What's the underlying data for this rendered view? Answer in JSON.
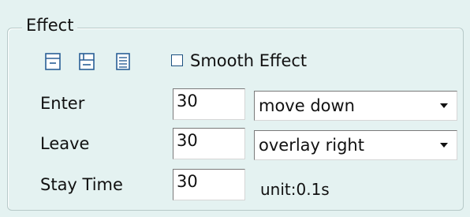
{
  "effect": {
    "title": "Effect",
    "toolbar_icons": [
      "page-top-icon",
      "page-middle-icon",
      "page-lines-icon"
    ],
    "smooth_effect_label": "Smooth Effect",
    "smooth_effect_checked": false,
    "rows": [
      {
        "label": "Enter",
        "value": "30",
        "select": "move down"
      },
      {
        "label": "Leave",
        "value": "30",
        "select": "overlay right"
      },
      {
        "label": "Stay Time",
        "value": "30",
        "unit": "unit:0.1s"
      }
    ]
  }
}
